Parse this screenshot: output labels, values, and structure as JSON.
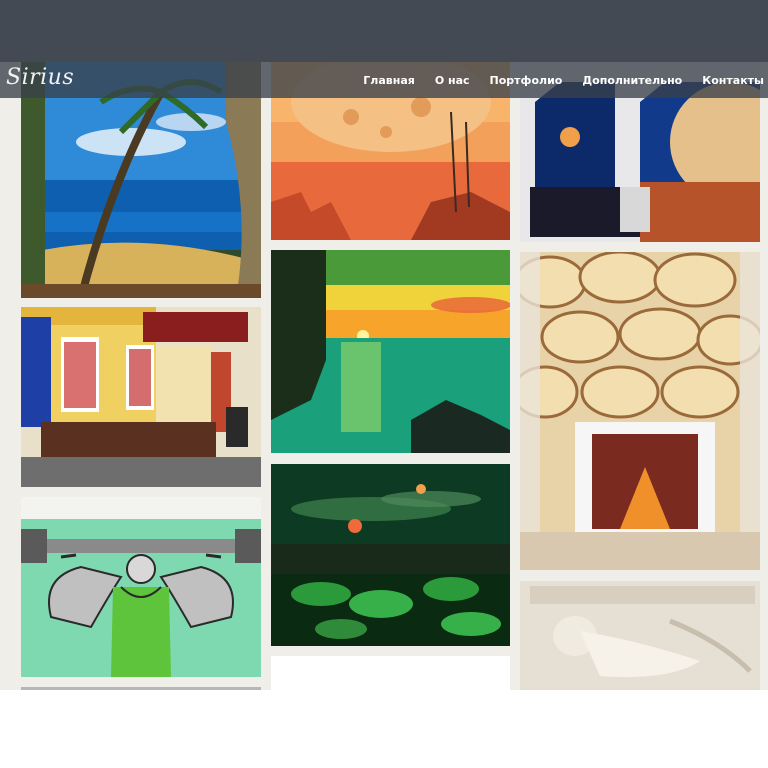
{
  "site": {
    "logo": "Sirius"
  },
  "nav": [
    {
      "label": "Главная"
    },
    {
      "label": "О нас"
    },
    {
      "label": "Портфолио"
    },
    {
      "label": "Дополнительно"
    },
    {
      "label": "Контакты"
    }
  ],
  "colors": {
    "header": "#434a54",
    "navbar": "#3a404a",
    "gallery_bg": "#efeee9"
  },
  "gallery": [
    {
      "name": "tropical-beach-mural"
    },
    {
      "name": "red-planet-sunset-painting"
    },
    {
      "name": "space-room-mural"
    },
    {
      "name": "cafe-storefront-facade"
    },
    {
      "name": "green-lake-sunset-painting"
    },
    {
      "name": "stone-fireplace-wall"
    },
    {
      "name": "athlete-barbell-mural"
    },
    {
      "name": "night-moon-leaves-painting"
    },
    {
      "name": "reclining-woman-relief"
    }
  ]
}
